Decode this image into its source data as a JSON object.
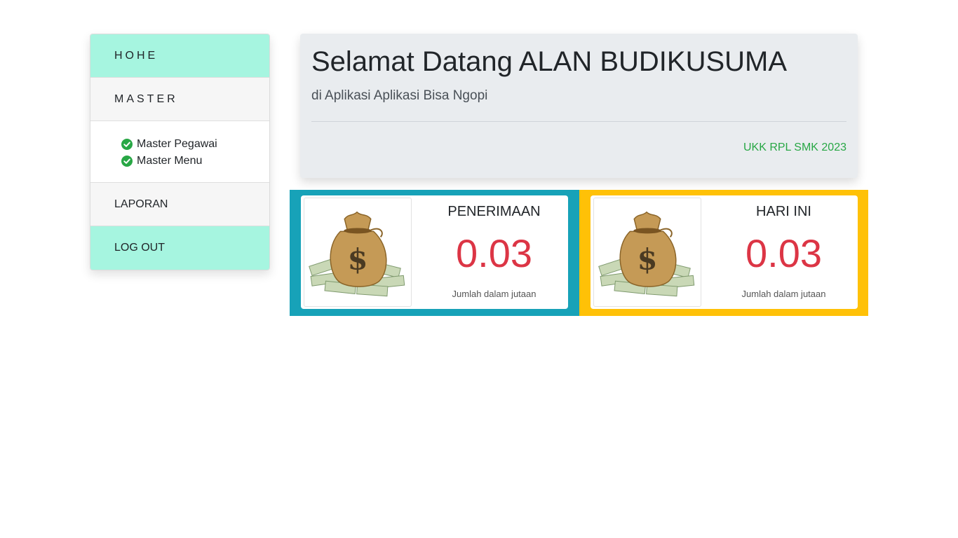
{
  "sidebar": {
    "home": "HOHE",
    "master": "MASTER",
    "master_items": [
      "Master Pegawai",
      "Master Menu"
    ],
    "laporan": "LAPORAN",
    "logout": "LOG OUT"
  },
  "jumbotron": {
    "title": "Selamat Datang ALAN BUDIKUSUMA",
    "subtitle": "di Aplikasi Aplikasi Bisa Ngopi",
    "footer": "UKK RPL SMK 2023"
  },
  "cards": [
    {
      "label": "PENERIMAAN",
      "value": "0.03",
      "note": "Jumlah dalam jutaan",
      "panel_color": "#17a2b8"
    },
    {
      "label": "HARI INI",
      "value": "0.03",
      "note": "Jumlah dalam jutaan",
      "panel_color": "#ffc107"
    }
  ],
  "colors": {
    "mint": "#a6f5e0",
    "value_red": "#dc3545",
    "footer_green": "#28a745"
  }
}
